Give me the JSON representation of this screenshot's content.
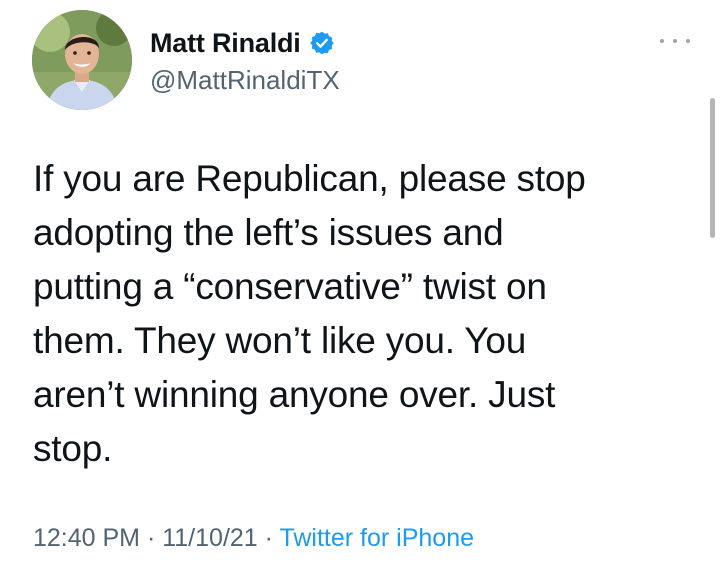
{
  "author": {
    "display_name": "Matt Rinaldi",
    "handle": "@MattRinaldiTX",
    "verified": true,
    "avatar_icon": "profile-photo"
  },
  "tweet": {
    "text": "If you are Republican, please stop\nadopting the left’s issues and\nputting a “conservative” twist on\nthem. They won’t like you. You\naren’t winning anyone over. Just\nstop.",
    "time": "12:40 PM",
    "separator": " · ",
    "date": "11/10/21",
    "source": "Twitter for iPhone"
  },
  "icons": {
    "verified": "verified-badge-icon",
    "more": "more-options-icon"
  },
  "colors": {
    "text": "#0f1419",
    "secondary": "#536471",
    "accent": "#1d9bf0"
  }
}
